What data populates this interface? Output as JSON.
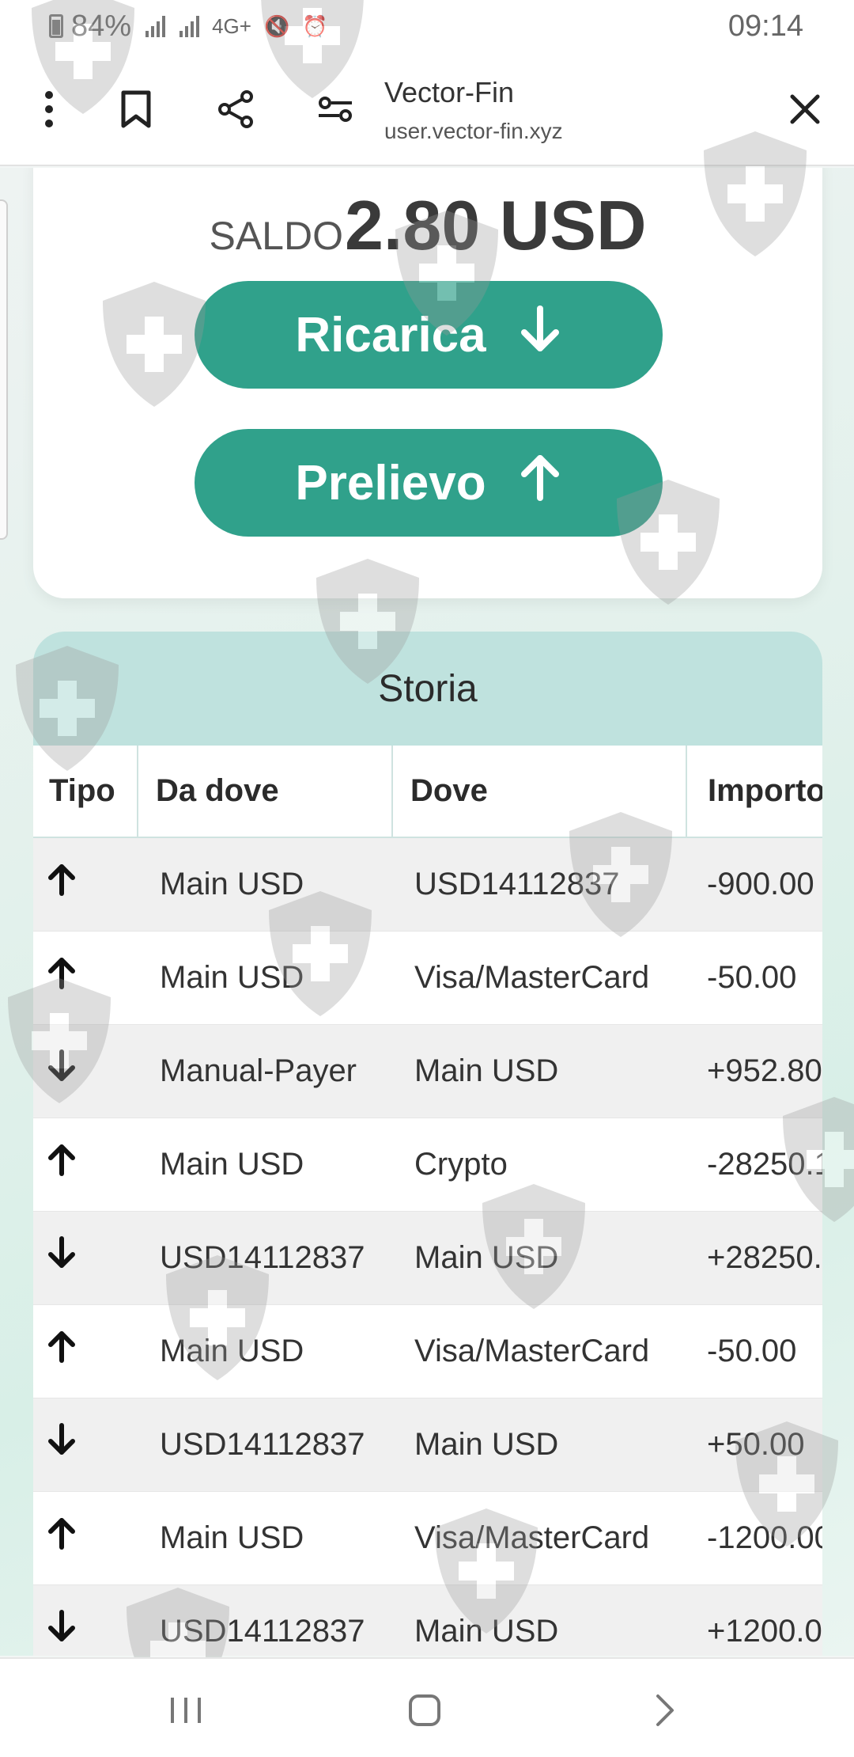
{
  "status_bar": {
    "battery": "84%",
    "network": "4G+",
    "time": "09:14"
  },
  "browser": {
    "title": "Vector-Fin",
    "url": "user.vector-fin.xyz",
    "icons": [
      "more-vert-icon",
      "bookmark-icon",
      "share-icon",
      "tune-icon",
      "close-icon"
    ]
  },
  "balance": {
    "label": "SALDO",
    "amount": "2.80 USD"
  },
  "buttons": {
    "deposit_label": "Ricarica",
    "withdraw_label": "Prelievo"
  },
  "history": {
    "title": "Storia",
    "columns": [
      "Tipo",
      "Da dove",
      "Dove",
      "Importo"
    ],
    "rows": [
      {
        "direction": "up",
        "from": "Main USD",
        "to": "USD14112837",
        "amount": "-900.00"
      },
      {
        "direction": "up",
        "from": "Main USD",
        "to": "Visa/MasterCard",
        "amount": "-50.00"
      },
      {
        "direction": "down",
        "from": "Manual-Payer",
        "to": "Main USD",
        "amount": "+952.80"
      },
      {
        "direction": "up",
        "from": "Main USD",
        "to": "Crypto",
        "amount": "-28250.1"
      },
      {
        "direction": "down",
        "from": "USD14112837",
        "to": "Main USD",
        "amount": "+28250."
      },
      {
        "direction": "up",
        "from": "Main USD",
        "to": "Visa/MasterCard",
        "amount": "-50.00"
      },
      {
        "direction": "down",
        "from": "USD14112837",
        "to": "Main USD",
        "amount": "+50.00"
      },
      {
        "direction": "up",
        "from": "Main USD",
        "to": "Visa/MasterCard",
        "amount": "-1200.00"
      },
      {
        "direction": "down",
        "from": "USD14112837",
        "to": "Main USD",
        "amount": "+1200.0"
      }
    ]
  },
  "colors": {
    "accent": "#30a18b",
    "header_bg": "#bfe2de",
    "watermark": "#9a9a9a"
  }
}
